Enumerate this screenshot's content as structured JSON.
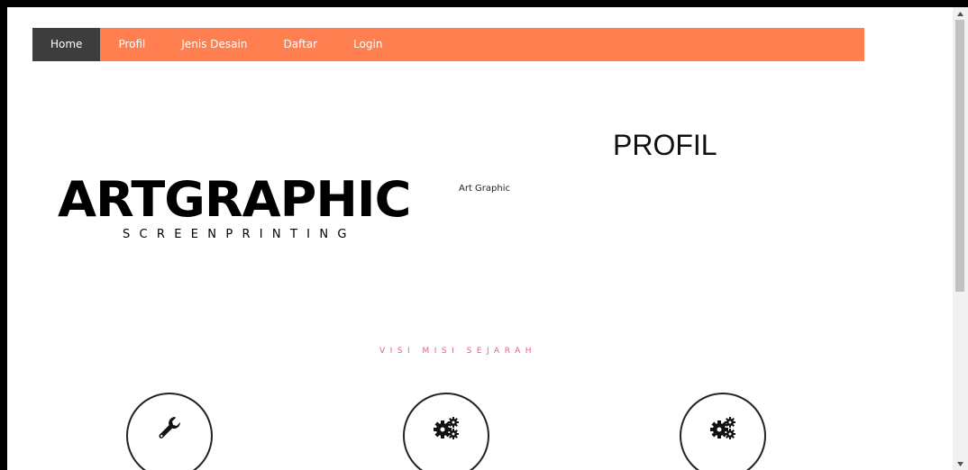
{
  "nav": {
    "items": [
      {
        "label": "Home",
        "active": true
      },
      {
        "label": "Profil",
        "active": false
      },
      {
        "label": "Jenis Desain",
        "active": false
      },
      {
        "label": "Daftar",
        "active": false
      },
      {
        "label": "Login",
        "active": false
      }
    ]
  },
  "logo": {
    "main": "ARTGRAPHIC",
    "sub": "SCREENPRINTING"
  },
  "profil": {
    "heading": "PROFIL",
    "text": "Art Graphic"
  },
  "section": {
    "title": "VISI MISI SEJARAH"
  },
  "features": [
    {
      "icon": "wrench-icon"
    },
    {
      "icon": "gears-icon"
    },
    {
      "icon": "gears-icon"
    }
  ],
  "colors": {
    "nav_bg": "#ff7f50",
    "nav_active_bg": "#3d3d3d",
    "section_title": "#e8617a"
  }
}
